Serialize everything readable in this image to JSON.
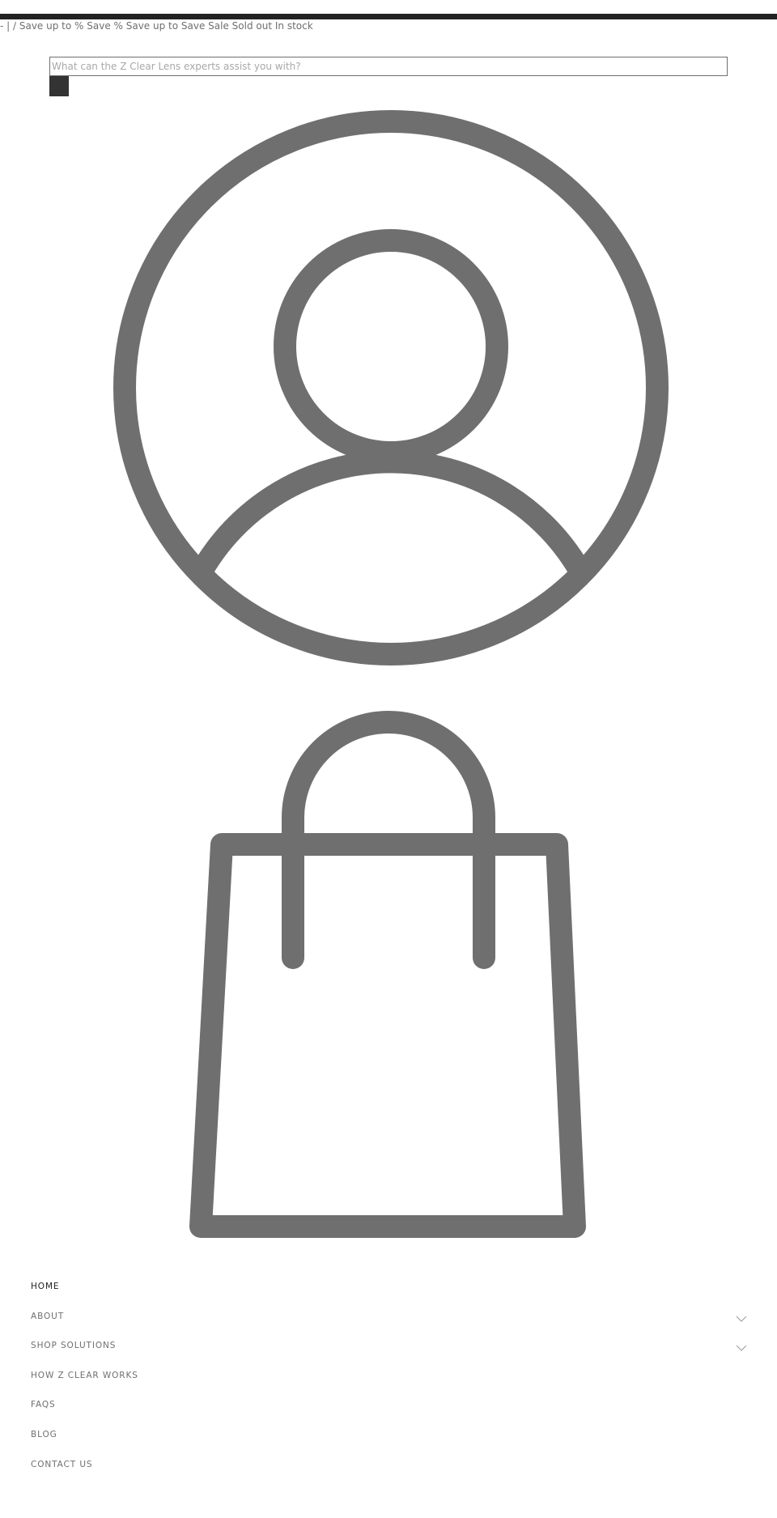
{
  "announcement": {
    "text": "- | / Save up to % Save % Save up to Save Sale Sold out In stock"
  },
  "search": {
    "placeholder": "What can the Z Clear Lens experts assist you with?"
  },
  "icons": {
    "account": "user-circle-icon",
    "cart": "shopping-bag-icon",
    "search_button": "search-icon",
    "expand": "chevron-down-icon"
  },
  "colors": {
    "top_bar": "#222222",
    "icon_stroke": "#6f6f6f",
    "search_button": "#333333",
    "nav_text": "#6f6f6f",
    "nav_active": "#222222"
  },
  "nav": {
    "items": [
      {
        "label": "HOME",
        "active": true,
        "has_submenu": false
      },
      {
        "label": "ABOUT",
        "active": false,
        "has_submenu": true
      },
      {
        "label": "SHOP SOLUTIONS",
        "active": false,
        "has_submenu": true
      },
      {
        "label": "HOW Z CLEAR WORKS",
        "active": false,
        "has_submenu": false
      },
      {
        "label": "FAQS",
        "active": false,
        "has_submenu": false
      },
      {
        "label": "BLOG",
        "active": false,
        "has_submenu": false
      },
      {
        "label": "CONTACT US",
        "active": false,
        "has_submenu": false
      }
    ]
  }
}
